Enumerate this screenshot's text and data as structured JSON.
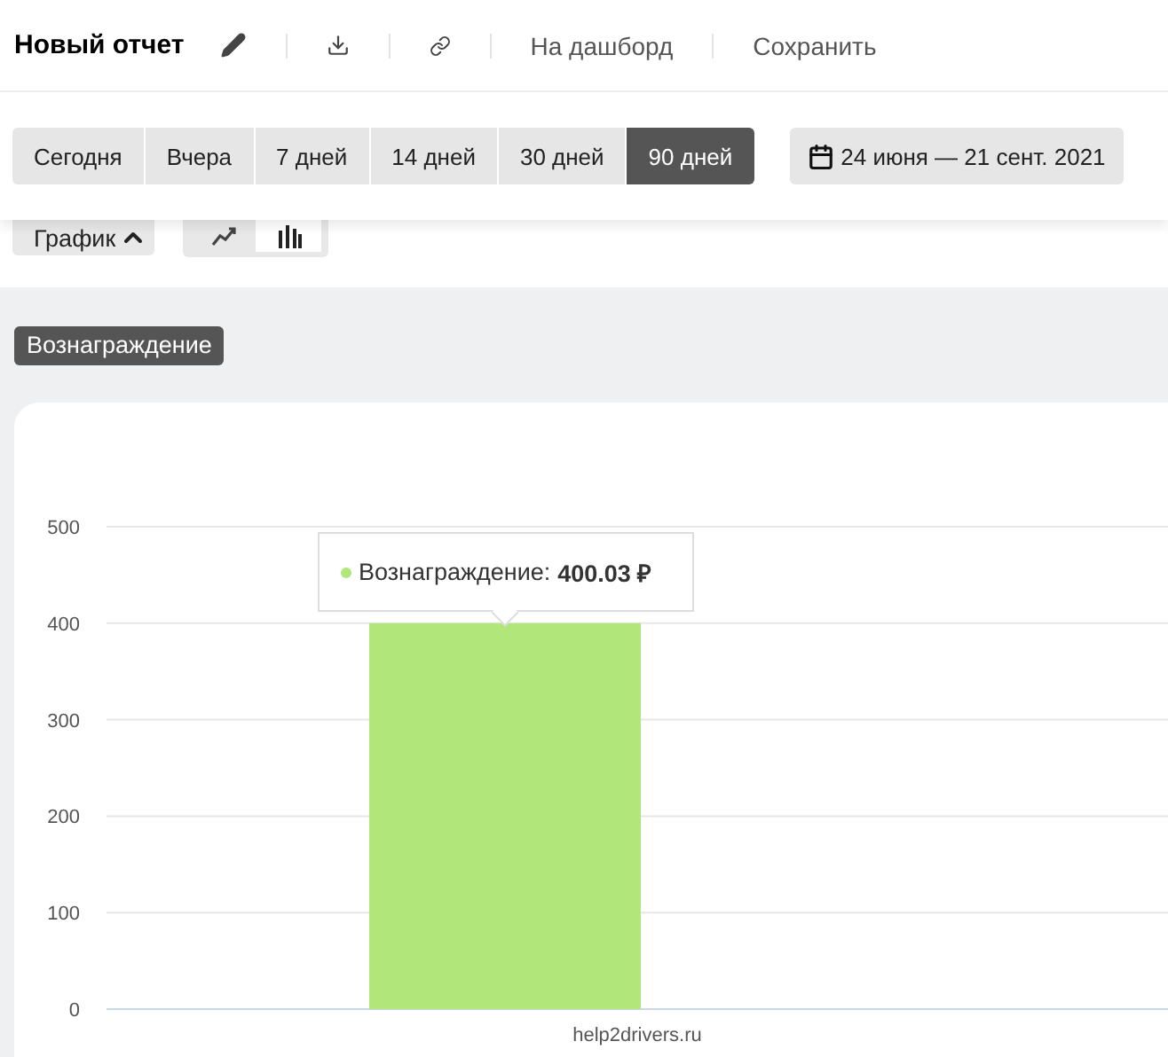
{
  "header": {
    "title": "Новый отчет",
    "links": [
      "На дашборд",
      "Сохранить"
    ]
  },
  "periods": [
    {
      "label": "Сегодня",
      "selected": false
    },
    {
      "label": "Вчера",
      "selected": false
    },
    {
      "label": "7 дней",
      "selected": false
    },
    {
      "label": "14 дней",
      "selected": false
    },
    {
      "label": "30 дней",
      "selected": false
    },
    {
      "label": "90 дней",
      "selected": true
    }
  ],
  "date_range": "24 июня — 21 сент. 2021",
  "view": {
    "label": "График",
    "expanded": true,
    "chart_types": [
      {
        "kind": "line",
        "selected": false
      },
      {
        "kind": "bar",
        "selected": true
      }
    ]
  },
  "metric_badge": "Вознаграждение",
  "chart": {
    "chart_data": {
      "type": "bar",
      "categories": [
        "help2drivers.ru"
      ],
      "series": [
        {
          "color": "#b1e67a",
          "values": [
            400
          ]
        }
      ],
      "grid": true,
      "ylim": [
        0,
        500
      ],
      "yticks": [
        0,
        100,
        200,
        300,
        400,
        500
      ]
    },
    "tooltip": {
      "label": "Вознаграждение:",
      "value": "400.03 ₽"
    }
  }
}
